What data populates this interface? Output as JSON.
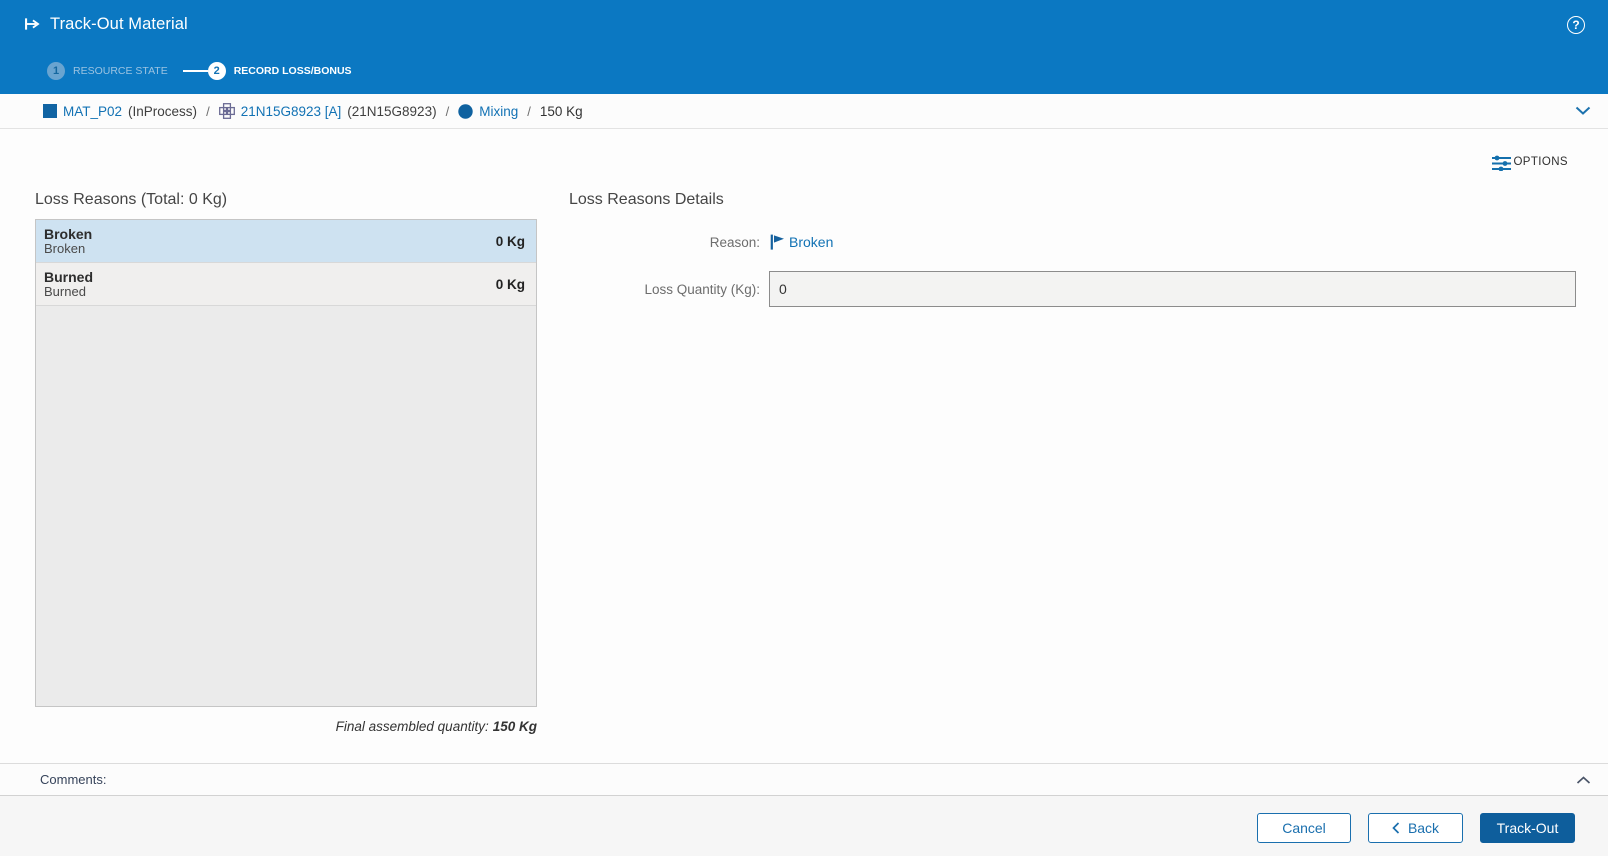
{
  "colors": {
    "header_blue": "#0b78c2",
    "dark_blue": "#0f5f9d",
    "link_blue": "#1272b4",
    "selected_row_bg": "#cee2f1",
    "primary_btn_bg": "#0e5e9c",
    "btn_blue": "#1a6fae"
  },
  "header": {
    "title": "Track-Out Material",
    "help_icon": "?",
    "steps": [
      {
        "number": "1",
        "label": "RESOURCE STATE",
        "state": "done"
      },
      {
        "number": "2",
        "label": "RECORD LOSS/BONUS",
        "state": "active"
      }
    ]
  },
  "breadcrumb": {
    "separator": "/",
    "items": [
      {
        "icon": "material-square-icon",
        "link": "MAT_P02",
        "suffix": "(InProcess)"
      },
      {
        "icon": "flow-step-icon",
        "link": "21N15G8923 [A]",
        "suffix": "(21N15G8923)"
      },
      {
        "icon": "step-circle-icon",
        "link": "Mixing"
      },
      {
        "plain": "150 Kg"
      }
    ]
  },
  "toolbar": {
    "options_label": "OPTIONS"
  },
  "loss_reasons": {
    "title": "Loss Reasons (Total: 0 Kg)",
    "items": [
      {
        "name": "Broken",
        "description": "Broken",
        "quantity": "0 Kg",
        "selected": true
      },
      {
        "name": "Burned",
        "description": "Burned",
        "quantity": "0 Kg",
        "selected": false
      }
    ],
    "final_quantity_label": "Final assembled quantity:",
    "final_quantity_value": "150 Kg"
  },
  "details": {
    "title": "Loss Reasons Details",
    "reason_label": "Reason:",
    "reason_value": "Broken",
    "loss_quantity_label": "Loss Quantity (Kg):",
    "loss_quantity_value": "0"
  },
  "comments": {
    "label": "Comments:"
  },
  "footer": {
    "cancel_label": "Cancel",
    "back_label": "Back",
    "trackout_label": "Track-Out"
  }
}
